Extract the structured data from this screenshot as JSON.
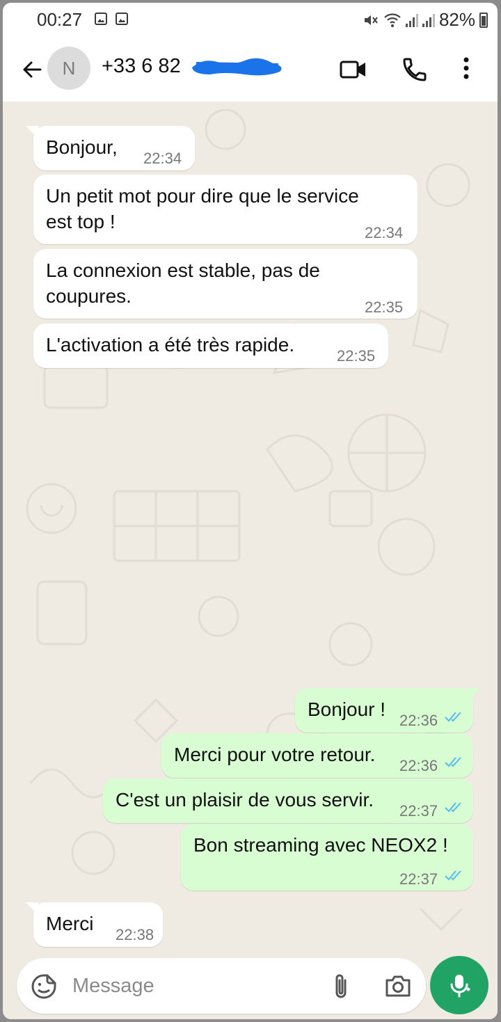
{
  "status_bar": {
    "time": "00:27",
    "battery": "82%",
    "icons": [
      "gallery-icon",
      "gallery-icon",
      "mute-icon",
      "wifi-icon",
      "signal-icon",
      "signal-icon",
      "battery-icon"
    ]
  },
  "header": {
    "avatar_letter": "N",
    "contact_visible": "+33 6 82",
    "contact_redacted": true,
    "icons": [
      "back-arrow-icon",
      "video-call-icon",
      "phone-icon",
      "more-vert-icon"
    ]
  },
  "messages": [
    {
      "dir": "in",
      "text": "Bonjour,",
      "time": "22:34"
    },
    {
      "dir": "in",
      "text_lines": [
        "Un petit mot pour dire que le service",
        "est top !"
      ],
      "time": "22:34"
    },
    {
      "dir": "in",
      "text_lines": [
        "La connexion est stable, pas de",
        "coupures."
      ],
      "time": "22:35"
    },
    {
      "dir": "in",
      "text": "L'activation a été très rapide.",
      "time": "22:35"
    },
    {
      "dir": "out",
      "text": "Bonjour !",
      "time": "22:36",
      "status": "read"
    },
    {
      "dir": "out",
      "text": "Merci pour votre retour.",
      "time": "22:36",
      "status": "read"
    },
    {
      "dir": "out",
      "text": "C'est un plaisir de vous servir.",
      "time": "22:37",
      "status": "read"
    },
    {
      "dir": "out",
      "text": "Bon streaming avec NEOX2 !",
      "time": "22:37",
      "status": "read"
    },
    {
      "dir": "in",
      "text": "Merci",
      "time": "22:38"
    }
  ],
  "input": {
    "placeholder": "Message",
    "icons": [
      "sticker-icon",
      "attach-icon",
      "camera-icon",
      "mic-icon"
    ]
  },
  "colors": {
    "chat_bg": "#efeae2",
    "incoming_bubble": "#ffffff",
    "outgoing_bubble": "#d9fdd3",
    "read_ticks": "#53bdeb",
    "mic_button": "#21a366",
    "redaction": "#1a73e8"
  }
}
